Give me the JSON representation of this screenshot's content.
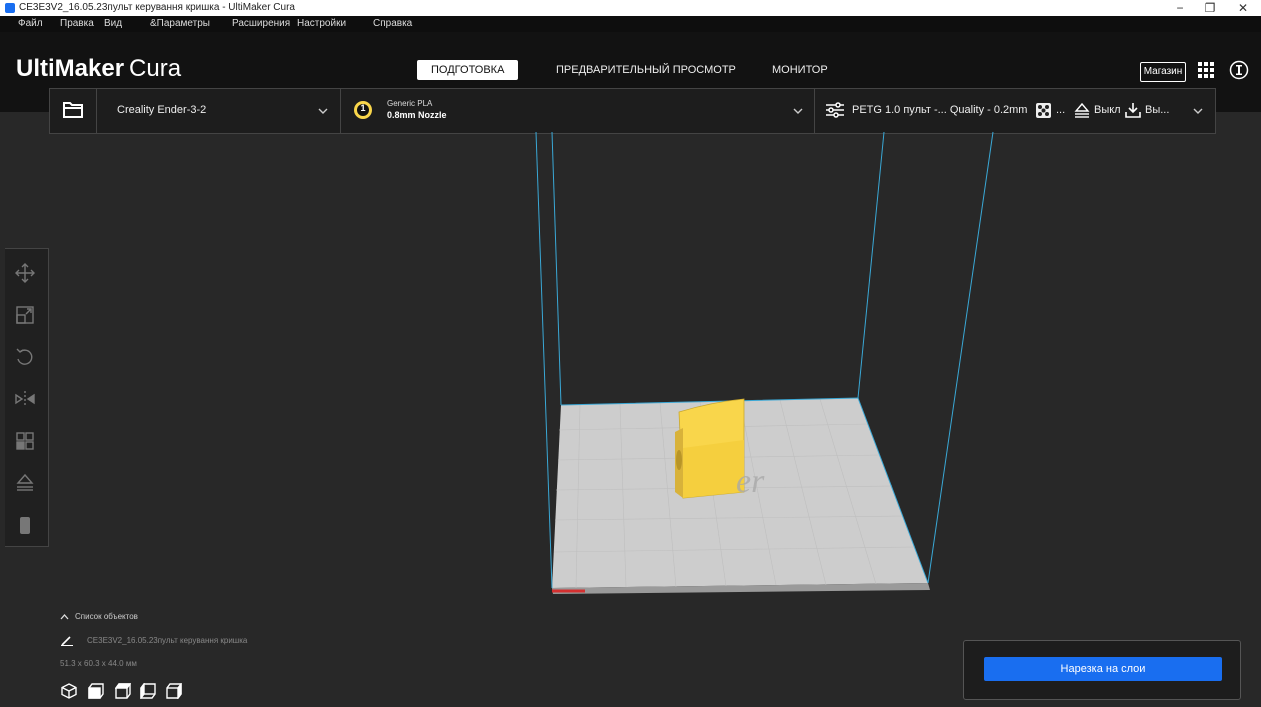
{
  "window": {
    "title": "CE3E3V2_16.05.23пульт керування кришка - UltiMaker Cura",
    "minimize_glyph": "−",
    "restore_glyph": "❐",
    "close_glyph": "✕"
  },
  "menu": {
    "items": [
      "Файл",
      "Правка",
      "Вид",
      "&Параметры",
      "Расширения",
      "Настройки",
      "Справка"
    ]
  },
  "header": {
    "logo_bold": "UltiMaker",
    "logo_light": "Cura",
    "tabs": [
      {
        "label": "ПОДГОТОВКА",
        "active": true
      },
      {
        "label": "ПРЕДВАРИТЕЛЬНЫЙ ПРОСМОТР",
        "active": false
      },
      {
        "label": "МОНИТОР",
        "active": false
      }
    ],
    "marketplace_label": "Магазин"
  },
  "toolbar": {
    "printer_name": "Creality Ender-3-2",
    "extruder_number": "1",
    "material_name": "Generic PLA",
    "nozzle": "0.8mm Nozzle",
    "profile_summary": "PETG 1.0 пульт -... Quality - 0.2mm",
    "support_value": "...",
    "adhesion_value": "Выкл",
    "save_value": "Вы..."
  },
  "objects": {
    "header_label": "Список объектов",
    "object_name": "CE3E3V2_16.05.23пульт керування кришка",
    "dimensions": "51.3 x 60.3 x 44.0 мм"
  },
  "action": {
    "slice_label": "Нарезка на слои"
  },
  "colors": {
    "accent": "#196ef0",
    "model": "#f9d64b",
    "plate": "#cfcfcf",
    "build_volume_lines": "#3aa8d6"
  },
  "icons": {
    "left_tools": [
      "move-icon",
      "scale-icon",
      "rotate-icon",
      "mirror-icon",
      "per-model-settings-icon",
      "support-blocker-icon",
      "trash-icon"
    ],
    "view_buttons": [
      "3d-view-icon",
      "front-view-icon",
      "top-view-icon",
      "left-view-icon",
      "right-view-icon"
    ]
  }
}
